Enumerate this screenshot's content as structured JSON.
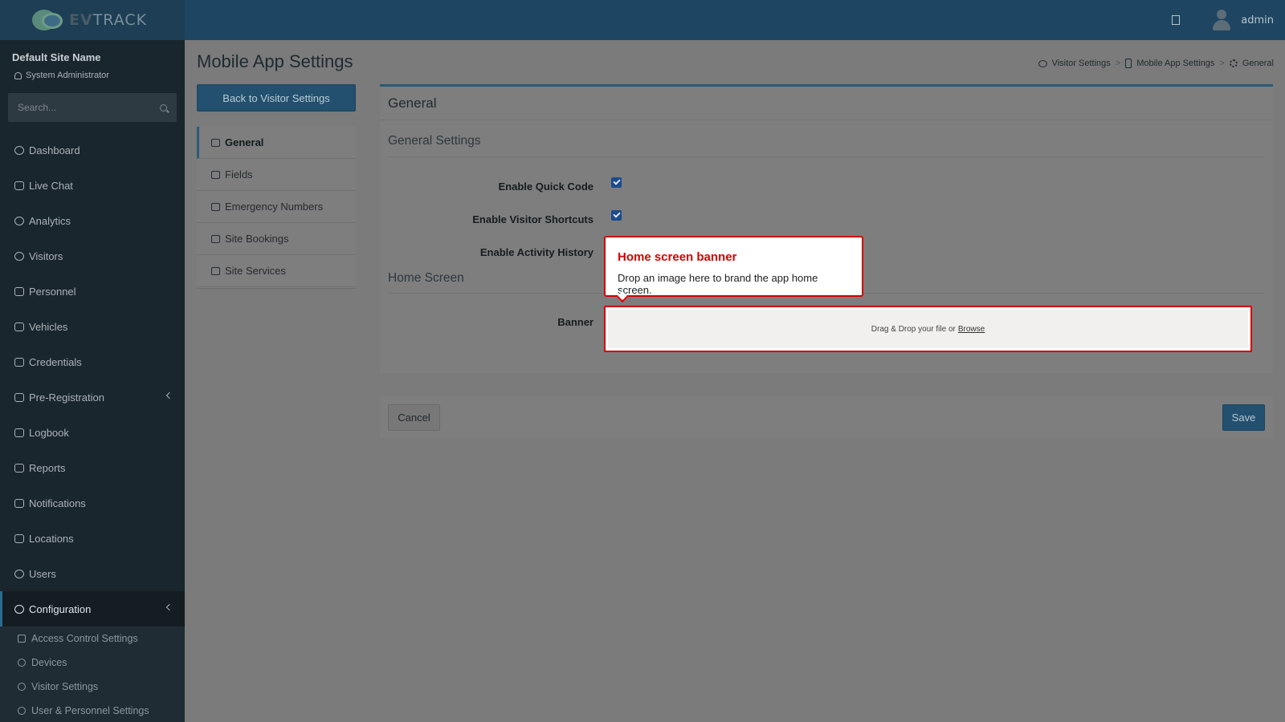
{
  "brand": {
    "logo_text_bold": "EV",
    "logo_text_rest": "TRACK"
  },
  "topbar": {
    "user": "admin"
  },
  "sidebar": {
    "site_name": "Default Site Name",
    "role": "System Administrator",
    "search_placeholder": "Search...",
    "items": [
      {
        "label": "Dashboard"
      },
      {
        "label": "Live Chat"
      },
      {
        "label": "Analytics"
      },
      {
        "label": "Visitors"
      },
      {
        "label": "Personnel"
      },
      {
        "label": "Vehicles"
      },
      {
        "label": "Credentials"
      },
      {
        "label": "Pre-Registration"
      },
      {
        "label": "Logbook"
      },
      {
        "label": "Reports"
      },
      {
        "label": "Notifications"
      },
      {
        "label": "Locations"
      },
      {
        "label": "Users"
      },
      {
        "label": "Configuration"
      }
    ],
    "sub_items": [
      {
        "label": "Access Control Settings"
      },
      {
        "label": "Devices"
      },
      {
        "label": "Visitor Settings"
      },
      {
        "label": "User & Personnel Settings"
      }
    ]
  },
  "page": {
    "title": "Mobile App Settings",
    "breadcrumb": [
      "Visitor Settings",
      "Mobile App Settings",
      "General"
    ],
    "back_button": "Back to Visitor Settings"
  },
  "tabs": [
    {
      "label": "General"
    },
    {
      "label": "Fields"
    },
    {
      "label": "Emergency Numbers"
    },
    {
      "label": "Site Bookings"
    },
    {
      "label": "Site Services"
    }
  ],
  "card": {
    "title": "General",
    "general_section": "General Settings",
    "fields": {
      "quick_code": {
        "label": "Enable Quick Code",
        "checked": true
      },
      "visitor_shortcuts": {
        "label": "Enable Visitor Shortcuts",
        "checked": true
      },
      "activity_history": {
        "label": "Enable Activity History"
      }
    },
    "home_section": "Home Screen",
    "banner_label": "Banner",
    "dropzone_text": "Drag & Drop your file or",
    "dropzone_browse": "Browse"
  },
  "callout": {
    "title": "Home screen banner",
    "text": "Drop an image here to brand the app home screen."
  },
  "footer": {
    "cancel": "Cancel",
    "save": "Save"
  },
  "colors": {
    "accent": "#22506e",
    "highlight": "#d40000",
    "sidebar": "#1a262d"
  }
}
